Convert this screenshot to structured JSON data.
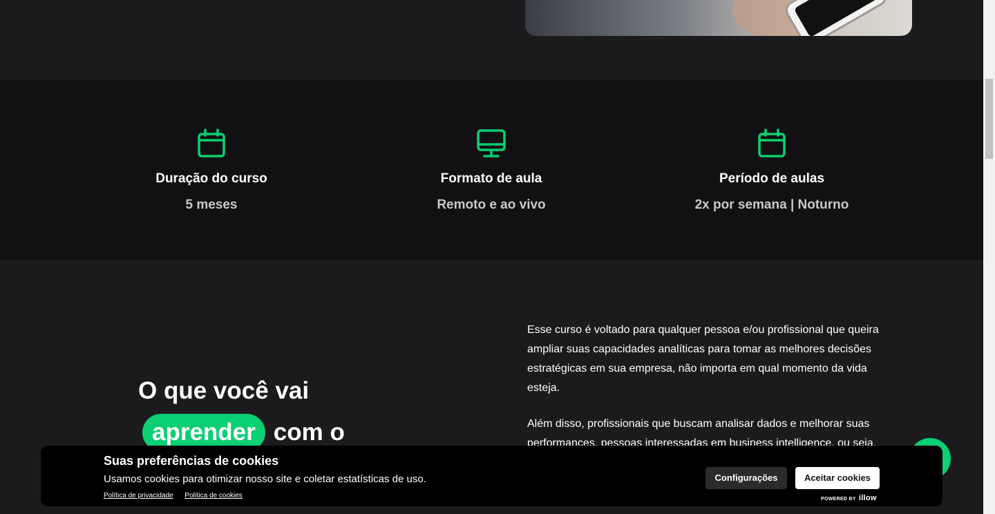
{
  "info": {
    "items": [
      {
        "icon": "calendar-icon",
        "title": "Duração do curso",
        "value": "5 meses"
      },
      {
        "icon": "monitor-icon",
        "title": "Formato de aula",
        "value": "Remoto e ao vivo"
      },
      {
        "icon": "calendar-icon",
        "title": "Período de aulas",
        "value": "2x por semana | Noturno"
      }
    ]
  },
  "learn": {
    "heading_line1": "O que você vai",
    "heading_highlight": "aprender",
    "heading_rest": "com o",
    "paragraphs": [
      "Esse curso é voltado para qualquer pessoa e/ou profissional que queira ampliar suas capacidades analíticas para tomar as melhores decisões estratégicas em sua empresa, não importa em qual momento da vida esteja.",
      "Além disso, profissionais que buscam analisar dados e melhorar suas performances, pessoas interessadas em business intelligence, ou seja, em"
    ]
  },
  "cookies": {
    "title": "Suas preferências de cookies",
    "description": "Usamos cookies para otimizar nosso site e coletar estatísticas de uso.",
    "privacy_link": "Política de privacidade",
    "cookies_link": "Política de cookies",
    "config_button": "Configurações",
    "accept_button": "Aceitar cookies",
    "powered_label": "POWERED BY",
    "powered_brand": "illow"
  },
  "colors": {
    "accent": "#0acf73",
    "background": "#1b1b1e",
    "band": "#111113"
  }
}
